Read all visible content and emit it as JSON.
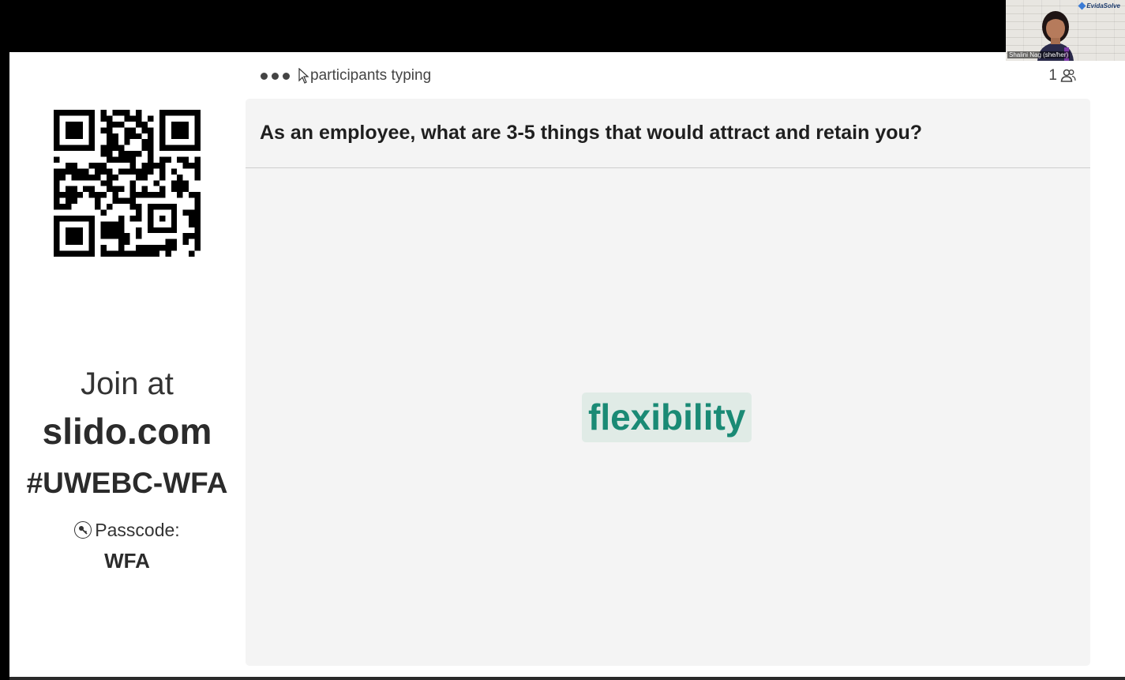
{
  "video": {
    "participant_name": "Shalini Nag (she/her)",
    "brand": "EvidaSolve"
  },
  "join": {
    "label": "Join at",
    "url": "slido.com",
    "event_code": "#UWEBC-WFA",
    "passcode_label": "Passcode:",
    "passcode_value": "WFA",
    "passcode_icon": "key-icon"
  },
  "status": {
    "typing_text": "participants typing",
    "participant_count": "1",
    "count_icon": "people-icon"
  },
  "poll": {
    "question": "As an employee, what are 3-5 things that would attract and retain you?",
    "words": [
      {
        "text": "flexibility",
        "color": "#1a8a75"
      }
    ]
  }
}
